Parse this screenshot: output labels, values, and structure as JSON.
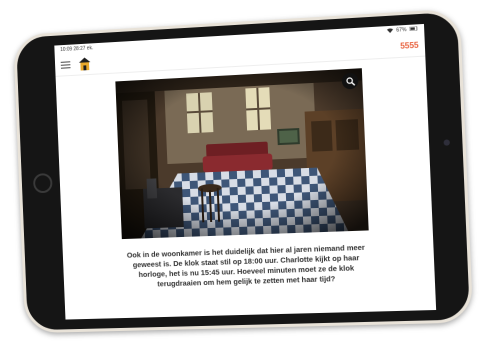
{
  "status_bar": {
    "time": "10:09",
    "date": "28:27 ek.",
    "battery": "67%"
  },
  "app_bar": {
    "score": "5555"
  },
  "icons": {
    "menu": "hamburger-menu-icon",
    "logo": "house-logo-icon",
    "zoom": "zoom-in-icon"
  },
  "colors": {
    "accent": "#e8603c",
    "screen_bg": "#ffffff",
    "bezel": "#151515"
  },
  "question": {
    "lines": [
      "Ook in de woonkamer is het duidelijk dat hier al jaren niemand meer",
      "geweest is. De klok staat stil op 18:00 uur. Charlotte kijkt op haar",
      "horloge, het is nu 15:45 uur. Hoeveel minuten moet ze de klok",
      "terugdraaien om hem gelijk te zetten met haar tijd?"
    ]
  }
}
